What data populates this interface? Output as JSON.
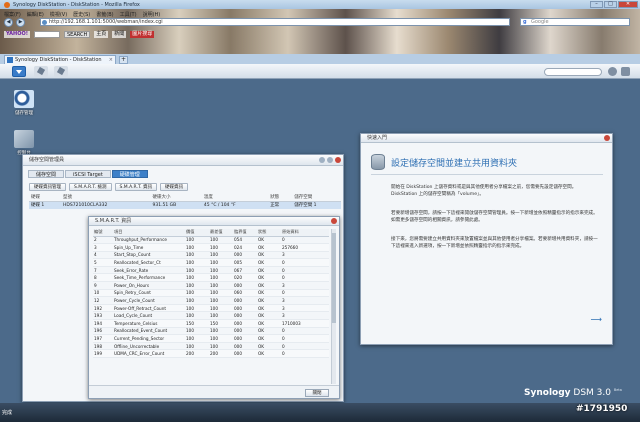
{
  "browser": {
    "title": "Synology DiskStation - DiskStation - Mozilla Firefox",
    "menu": [
      "檔案(F)",
      "編輯(E)",
      "檢視(V)",
      "歷史(S)",
      "書籤(B)",
      "工具(T)",
      "說明(H)"
    ],
    "url": "http://192.168.1.101:5000/webman/index.cgi",
    "search_placeholder": "Google",
    "toolbar": {
      "yahoo": "YAHOO!",
      "search_button": "SEARCH",
      "btn1": "主頁",
      "btn2": "新聞",
      "btn3": "圖片搜尋"
    },
    "tab_title": "Synology DiskStation - DiskStation",
    "tab_add": "+",
    "status": "完成",
    "window_buttons": {
      "min": "–",
      "max": "□",
      "close": "✕"
    }
  },
  "desktop": {
    "icons": [
      {
        "label": "儲存管理"
      },
      {
        "label": "控制台"
      }
    ]
  },
  "storage_manager": {
    "title": "儲存空間管理員",
    "tabs": [
      "儲存空間",
      "iSCSI Target",
      "硬碟管理"
    ],
    "active_tab": 2,
    "buttons": [
      "硬碟資訊管理",
      "S.M.A.R.T. 檢測",
      "S.M.A.R.T. 資訊",
      "硬碟資訊"
    ],
    "columns": [
      "硬碟",
      "型號",
      "硬碟大小",
      "溫度",
      "狀態",
      "儲存空間"
    ],
    "disks": [
      [
        "硬碟 1",
        "HDS721010CLA332",
        "931.51 GB",
        "45 °C / 104 °F",
        "正常",
        "儲存空間 1"
      ]
    ]
  },
  "smart": {
    "title": "S.M.A.R.T. 資訊",
    "columns": [
      "編號",
      "項目",
      "價值",
      "最差值",
      "臨界值",
      "狀態",
      "原始資料"
    ],
    "rows": [
      [
        "2",
        "Throughput_Performance",
        "100",
        "100",
        "054",
        "OK",
        "0"
      ],
      [
        "3",
        "Spin_Up_Time",
        "100",
        "100",
        "024",
        "OK",
        "257660"
      ],
      [
        "4",
        "Start_Stop_Count",
        "100",
        "100",
        "000",
        "OK",
        "3"
      ],
      [
        "5",
        "Reallocated_Sector_Ct",
        "100",
        "100",
        "005",
        "OK",
        "0"
      ],
      [
        "7",
        "Seek_Error_Rate",
        "100",
        "100",
        "067",
        "OK",
        "0"
      ],
      [
        "8",
        "Seek_Time_Performance",
        "100",
        "100",
        "020",
        "OK",
        "0"
      ],
      [
        "9",
        "Power_On_Hours",
        "100",
        "100",
        "000",
        "OK",
        "3"
      ],
      [
        "10",
        "Spin_Retry_Count",
        "100",
        "100",
        "060",
        "OK",
        "0"
      ],
      [
        "12",
        "Power_Cycle_Count",
        "100",
        "100",
        "000",
        "OK",
        "3"
      ],
      [
        "192",
        "Power-Off_Retract_Count",
        "100",
        "100",
        "000",
        "OK",
        "3"
      ],
      [
        "193",
        "Load_Cycle_Count",
        "100",
        "100",
        "000",
        "OK",
        "3"
      ],
      [
        "194",
        "Temperature_Celsius",
        "150",
        "150",
        "000",
        "OK",
        "1710003"
      ],
      [
        "196",
        "Reallocated_Event_Count",
        "100",
        "100",
        "000",
        "OK",
        "0"
      ],
      [
        "197",
        "Current_Pending_Sector",
        "100",
        "100",
        "000",
        "OK",
        "0"
      ],
      [
        "198",
        "Offline_Uncorrectable",
        "100",
        "100",
        "000",
        "OK",
        "0"
      ],
      [
        "199",
        "UDMA_CRC_Error_Count",
        "200",
        "200",
        "000",
        "OK",
        "0"
      ]
    ],
    "close_label": "關閉"
  },
  "quick_start": {
    "window_title": "快速入門",
    "heading": "設定儲存空間並建立共用資料夾",
    "paragraphs": [
      "開始在 DiskStation 上儲存資料或是與其他使用者分享檔案之前，您需要先設定儲存空間。DiskStation 上的儲存空間稱為「volume」。",
      "若要新增儲存空間，請按一下這裡來開啟儲存空間管理員。按一下新增並依照精靈指示的指示來完成。如需更多儲存空間的相關資訊，請參閱此處。",
      "接下來，您將需要建立共用資料夾來放置檔案並與其他使用者分享檔案。若要新增共用資料夾，請按一下這裡來進入新選項，按一下新增並依照精靈指示的指示來完成。"
    ],
    "next": "⟶"
  },
  "dsm": {
    "brand": "Synology",
    "version": "DSM 3.0",
    "tag": "Beta"
  },
  "watermark": "#1791950"
}
